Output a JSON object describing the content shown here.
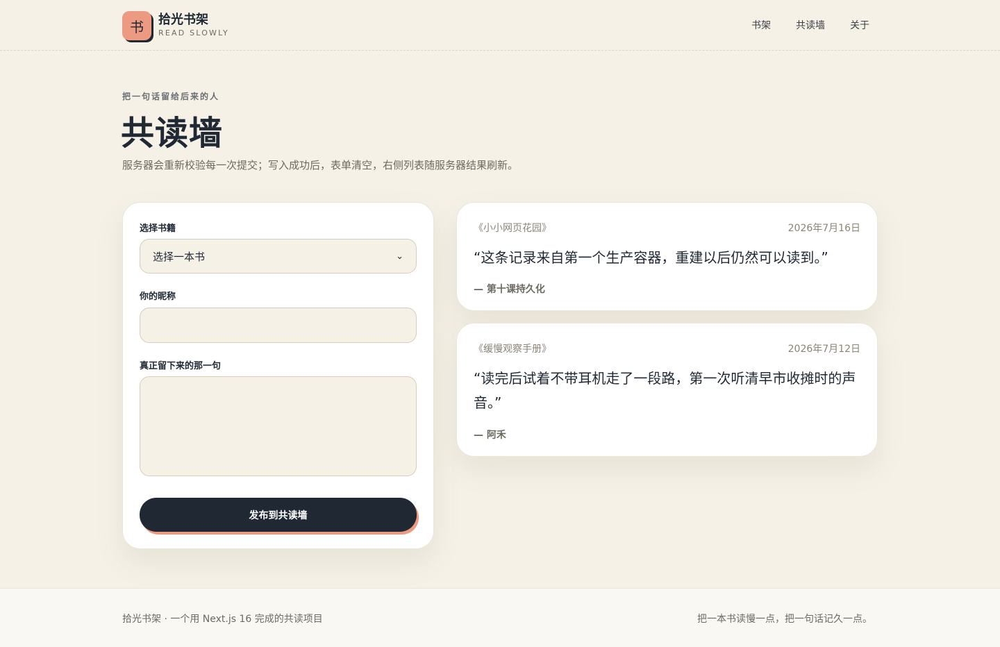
{
  "brand": {
    "logo_glyph": "书",
    "title": "拾光书架",
    "subtitle": "READ SLOWLY",
    "accent_color": "#ec9a82",
    "ink_color": "#1f2833"
  },
  "nav": {
    "items": [
      {
        "label": "书架"
      },
      {
        "label": "共读墙"
      },
      {
        "label": "关于"
      }
    ]
  },
  "hero": {
    "eyebrow": "把一句话留给后来的人",
    "title": "共读墙",
    "lead": "服务器会重新校验每一次提交；写入成功后，表单清空，右侧列表随服务器结果刷新。"
  },
  "form": {
    "book_label": "选择书籍",
    "book_selected": "选择一本书",
    "nickname_label": "你的昵称",
    "nickname_value": "",
    "sentence_label": "真正留下来的那一句",
    "sentence_value": "",
    "submit_label": "发布到共读墙"
  },
  "notes": [
    {
      "book": "《小小网页花园》",
      "date": "2026年7月16日",
      "quote": "“这条记录来自第一个生产容器，重建以后仍然可以读到。”",
      "author": "— 第十课持久化"
    },
    {
      "book": "《缓慢观察手册》",
      "date": "2026年7月12日",
      "quote": "“读完后试着不带耳机走了一段路，第一次听清早市收摊时的声音。”",
      "author": "— 阿禾"
    }
  ],
  "footer": {
    "left": "拾光书架 · 一个用 Next.js 16 完成的共读项目",
    "right": "把一本书读慢一点，把一句话记久一点。"
  }
}
